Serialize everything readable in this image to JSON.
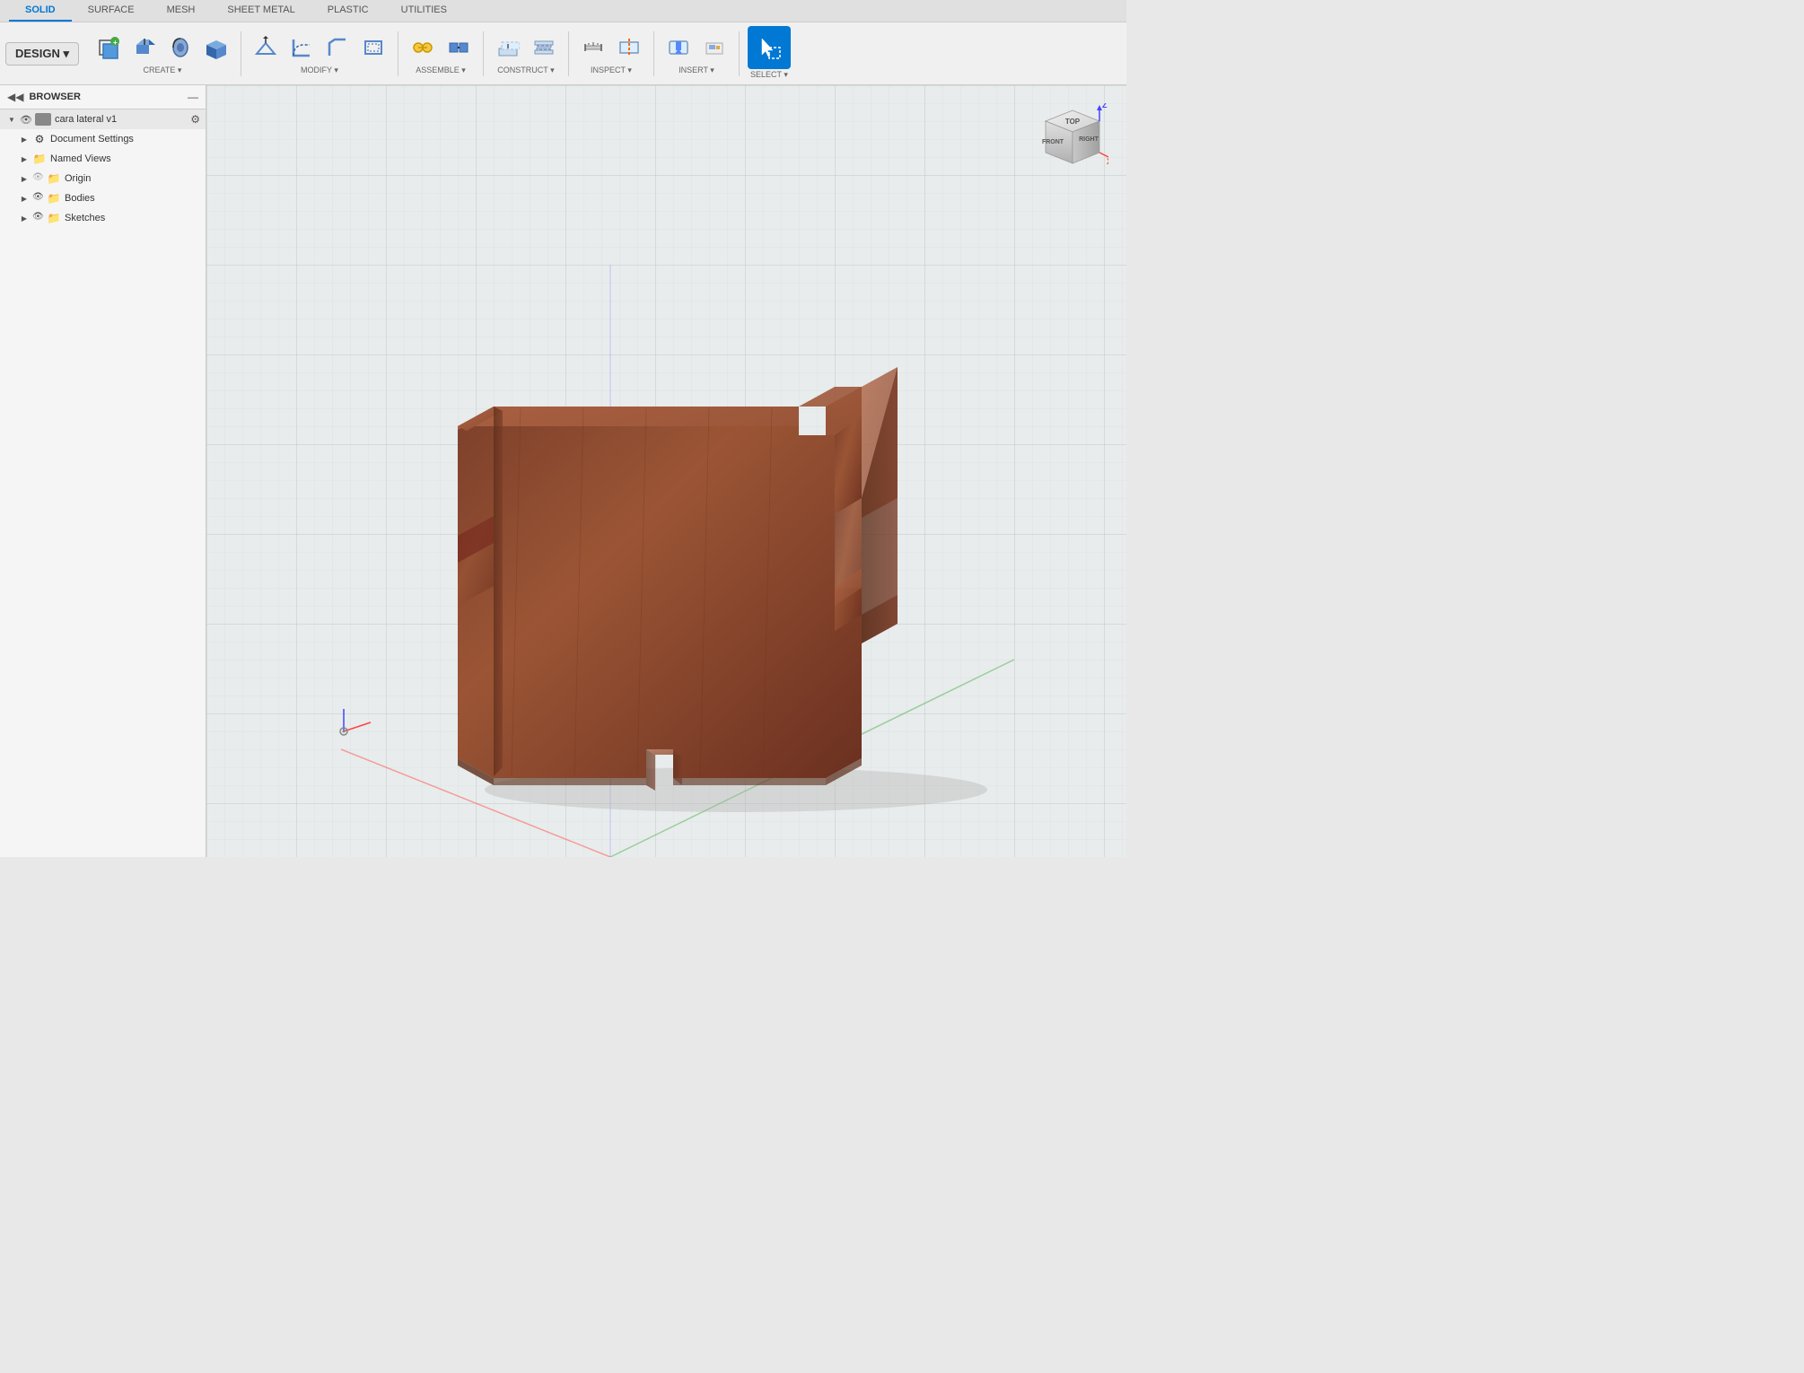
{
  "tabs": [
    {
      "label": "SOLID",
      "active": true
    },
    {
      "label": "SURFACE",
      "active": false
    },
    {
      "label": "MESH",
      "active": false
    },
    {
      "label": "SHEET METAL",
      "active": false
    },
    {
      "label": "PLASTIC",
      "active": false
    },
    {
      "label": "UTILITIES",
      "active": false
    }
  ],
  "design_btn": "DESIGN ▾",
  "toolbar": {
    "create_label": "CREATE ▾",
    "modify_label": "MODIFY ▾",
    "assemble_label": "ASSEMBLE ▾",
    "construct_label": "CONSTRUCT ▾",
    "inspect_label": "INSPECT ▾",
    "insert_label": "INSERT ▾",
    "select_label": "SELECT ▾"
  },
  "browser": {
    "title": "BROWSER"
  },
  "tree": {
    "root": "cara lateral v1",
    "items": [
      {
        "label": "Document Settings",
        "has_arrow": true,
        "has_eye": false
      },
      {
        "label": "Named Views",
        "has_arrow": true,
        "has_eye": false
      },
      {
        "label": "Origin",
        "has_arrow": true,
        "has_eye": true
      },
      {
        "label": "Bodies",
        "has_arrow": true,
        "has_eye": true
      },
      {
        "label": "Sketches",
        "has_arrow": true,
        "has_eye": true
      }
    ]
  },
  "viewcube": {
    "top_label": "TOP",
    "front_label": "FRONT",
    "right_label": "RIGHT"
  },
  "colors": {
    "model_brown_dark": "#6B3A2A",
    "model_brown_mid": "#8B4A35",
    "model_brown_light": "#A0604A",
    "model_brown_top": "#9B5540",
    "accent_blue": "#0078d4",
    "grid_line": "#d0d8d8",
    "axis_red": "#ff4444",
    "axis_green": "#44bb44",
    "axis_blue": "#4444ff"
  }
}
